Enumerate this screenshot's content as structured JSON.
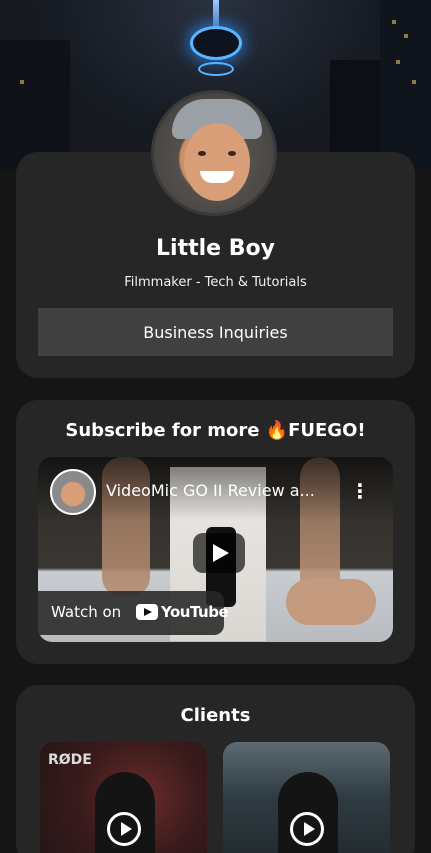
{
  "profile": {
    "name": "Little Boy",
    "tagline": "Filmmaker - Tech & Tutorials",
    "inquiry_button": "Business Inquiries"
  },
  "video_section": {
    "title": "Subscribe for more 🔥FUEGO!",
    "video_title": "VideoMic GO II Review a...",
    "more_icon": "⋮",
    "watch_label": "Watch on",
    "platform": "YouTube"
  },
  "clients_section": {
    "title": "Clients",
    "items": [
      {
        "mark": "RØDE",
        "icon": "play-circle-icon"
      },
      {
        "icon": "play-circle-icon"
      }
    ]
  },
  "colors": {
    "background": "#151515",
    "card": "#262626",
    "button": "#404040"
  }
}
